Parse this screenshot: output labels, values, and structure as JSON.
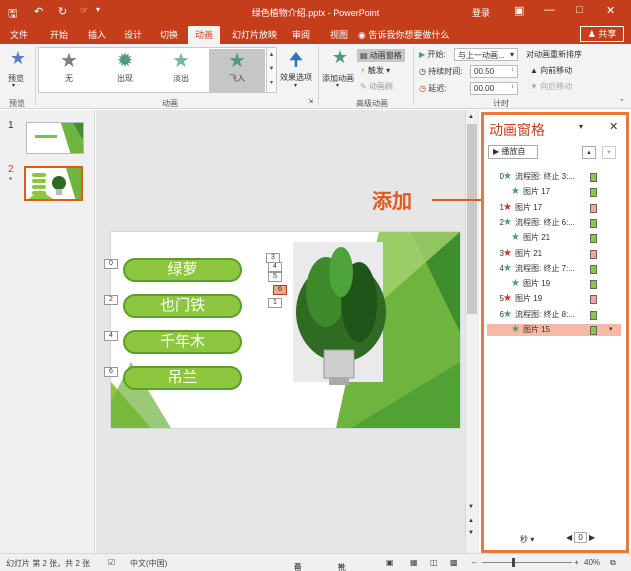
{
  "titlebar": {
    "title": "绿色植物介绍.pptx - PowerPoint",
    "login": "登录",
    "save_icon": "save-icon",
    "undo_icon": "undo-icon",
    "redo_icon": "redo-icon"
  },
  "tabs": [
    "文件",
    "开始",
    "插入",
    "设计",
    "切换",
    "动画",
    "幻灯片放映",
    "审阅",
    "视图"
  ],
  "active_tab": "动画",
  "tell_me": "告诉我你想要做什么",
  "share": "共享",
  "ribbon": {
    "preview": "预览",
    "preview_group": "预览",
    "animations": [
      {
        "label": "无",
        "color": "#7f7f7f"
      },
      {
        "label": "出现",
        "color": "#4f9a7b"
      },
      {
        "label": "淡出",
        "color": "#4f9a7b"
      },
      {
        "label": "飞入",
        "color": "#4f9a7b"
      }
    ],
    "effect_options": "效果选项",
    "animation_group": "动画",
    "add_animation": "添加动画",
    "animation_pane_btn": "动画窗格",
    "trigger": "触发",
    "animation_painter": "动画刷",
    "advanced_group": "高级动画",
    "start_label": "开始:",
    "start_value": "与上一动画...",
    "duration_label": "持续时间:",
    "duration_value": "00.50",
    "delay_label": "延迟:",
    "delay_value": "00.00",
    "timing_group": "计时",
    "reorder": "对动画重新排序",
    "move_earlier": "向前移动",
    "move_later": "向后移动"
  },
  "thumbs": [
    {
      "num": "1"
    },
    {
      "num": "2",
      "star": "*"
    }
  ],
  "slide": {
    "pills": [
      "绿萝",
      "也门铁",
      "千年木",
      "吊兰"
    ],
    "pill_tags": [
      "0",
      "2",
      "4",
      "6"
    ],
    "picture_tags": [
      "3",
      "4",
      "5",
      "6",
      "1"
    ]
  },
  "callout": "添加",
  "pane": {
    "title": "动画窗格",
    "play_from": "播放自",
    "rows": [
      {
        "num": "0",
        "text": "流程图: 终止 3:...",
        "star": "#4f9a7b",
        "bar": "#8dc63f"
      },
      {
        "num": "",
        "text": "图片 17",
        "star": "#4f9a7b",
        "bar": "#8dc63f"
      },
      {
        "num": "1",
        "text": "图片 17",
        "star": "#c0392b",
        "bar": "#f5a3a3"
      },
      {
        "num": "2",
        "text": "流程图: 终止 6:...",
        "star": "#4f9a7b",
        "bar": "#8dc63f"
      },
      {
        "num": "",
        "text": "图片 21",
        "star": "#4f9a7b",
        "bar": "#8dc63f"
      },
      {
        "num": "3",
        "text": "图片 21",
        "star": "#c0392b",
        "bar": "#f5a3a3"
      },
      {
        "num": "4",
        "text": "流程图: 终止 7:...",
        "star": "#4f9a7b",
        "bar": "#8dc63f"
      },
      {
        "num": "",
        "text": "图片 19",
        "star": "#4f9a7b",
        "bar": "#8dc63f"
      },
      {
        "num": "5",
        "text": "图片 19",
        "star": "#c0392b",
        "bar": "#f5a3a3"
      },
      {
        "num": "6",
        "text": "流程图: 终止 8:...",
        "star": "#4f9a7b",
        "bar": "#8dc63f"
      },
      {
        "num": "",
        "text": "图片 15",
        "star": "#4f9a7b",
        "bar": "#8dc63f",
        "selected": true
      }
    ],
    "seconds": "秒",
    "zoom_value": "0"
  },
  "status": {
    "slide_info": "幻灯片 第 2 张，共 2 张",
    "language": "中文(中国)",
    "notes": "备注",
    "comments": "批注",
    "zoom": "40%"
  },
  "colors": {
    "accent": "#c43e1c",
    "highlight": "#e8793b",
    "green": "#8dc63f"
  }
}
